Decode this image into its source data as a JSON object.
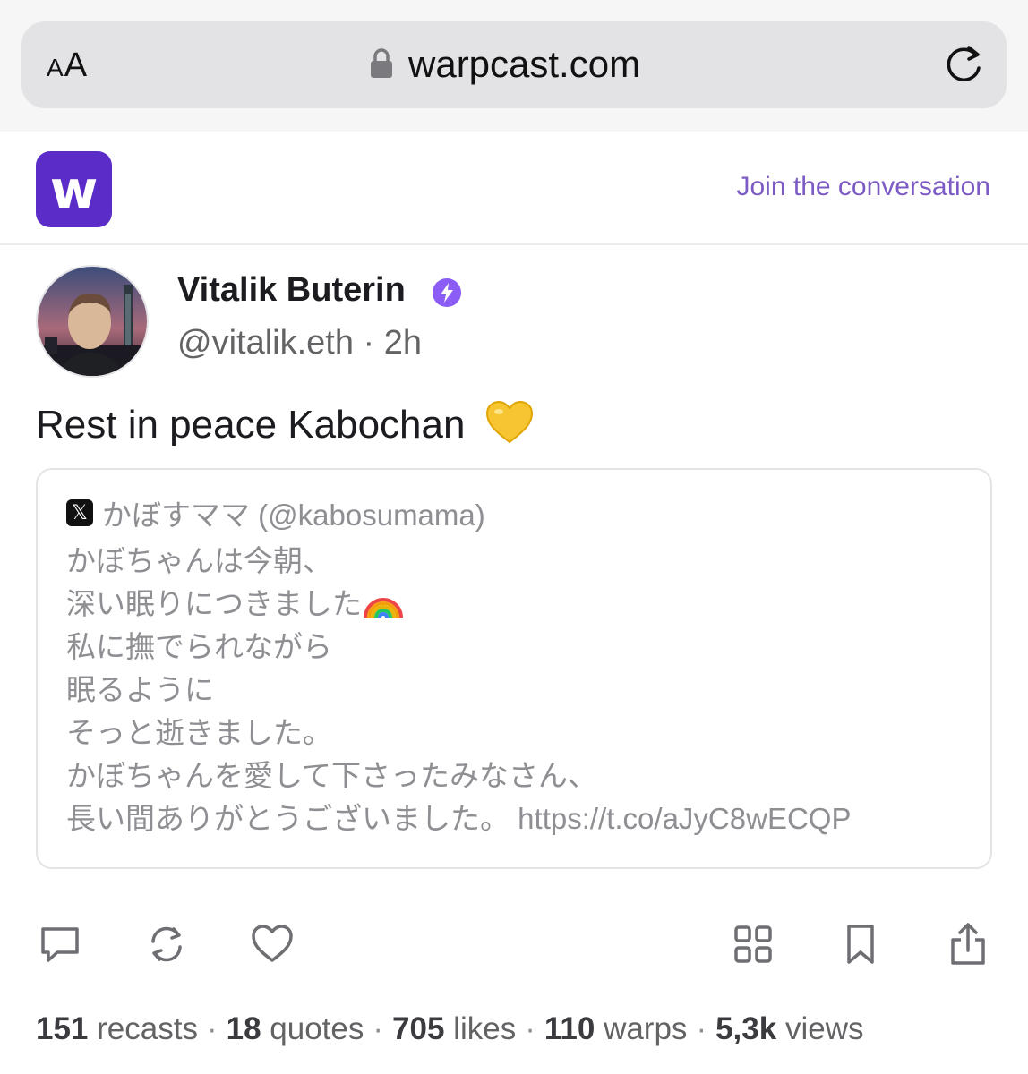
{
  "browser": {
    "aa_small": "A",
    "aa_large": "A",
    "url": "warpcast.com"
  },
  "header": {
    "logo_letter": "w",
    "join_label": "Join the conversation",
    "accent": "#5b2cc7"
  },
  "post": {
    "author_name": "Vitalik Buterin",
    "handle": "@vitalik.eth",
    "separator": "·",
    "time": "2h",
    "text": "Rest in peace Kabochan",
    "text_emoji": "yellow-heart",
    "quote": {
      "source_icon": "x-logo",
      "source": "かぼすママ (@kabosumama)",
      "lines": [
        "かぼちゃんは今朝、",
        "深い眠りにつきました",
        "私に撫でられながら",
        "眠るように",
        "そっと逝きました。",
        "かぼちゃんを愛して下さったみなさん、",
        "長い間ありがとうございました。"
      ],
      "link": "https://t.co/aJyC8wECQP"
    }
  },
  "stats": {
    "recasts_count": "151",
    "recasts_label": "recasts",
    "quotes_count": "18",
    "quotes_label": "quotes",
    "likes_count": "705",
    "likes_label": "likes",
    "warps_count": "110",
    "warps_label": "warps",
    "views_count": "5,3k",
    "views_label": "views",
    "dot": "·"
  }
}
